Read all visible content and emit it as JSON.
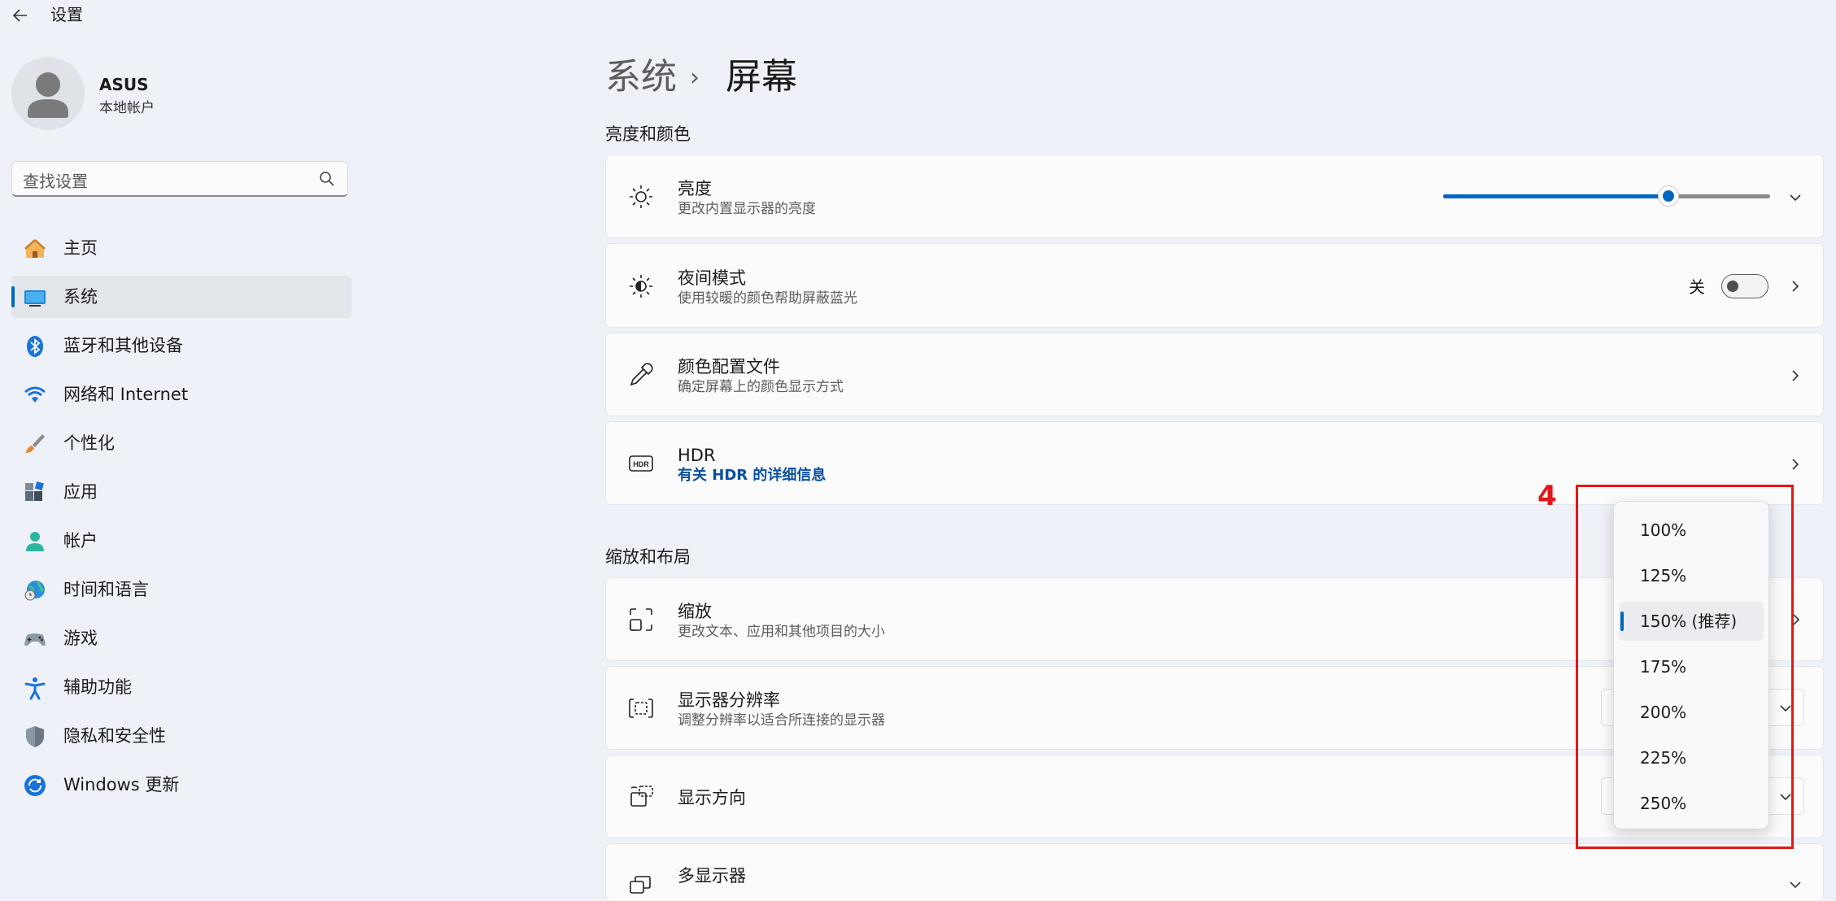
{
  "window": {
    "back_icon": "back-arrow-icon",
    "title": "设置"
  },
  "user": {
    "name": "ASUS",
    "account_type": "本地帐户",
    "avatar_icon": "person-icon"
  },
  "search": {
    "placeholder": "查找设置",
    "icon": "search-icon"
  },
  "nav": {
    "items": [
      {
        "label": "主页",
        "icon": "home-icon",
        "selected": false
      },
      {
        "label": "系统",
        "icon": "system-icon",
        "selected": true
      },
      {
        "label": "蓝牙和其他设备",
        "icon": "bluetooth-icon",
        "selected": false
      },
      {
        "label": "网络和 Internet",
        "icon": "wifi-icon",
        "selected": false
      },
      {
        "label": "个性化",
        "icon": "brush-icon",
        "selected": false
      },
      {
        "label": "应用",
        "icon": "apps-icon",
        "selected": false
      },
      {
        "label": "帐户",
        "icon": "account-icon",
        "selected": false
      },
      {
        "label": "时间和语言",
        "icon": "globe-clock-icon",
        "selected": false
      },
      {
        "label": "游戏",
        "icon": "gamepad-icon",
        "selected": false
      },
      {
        "label": "辅助功能",
        "icon": "accessibility-icon",
        "selected": false
      },
      {
        "label": "隐私和安全性",
        "icon": "shield-icon",
        "selected": false
      },
      {
        "label": "Windows 更新",
        "icon": "update-icon",
        "selected": false
      }
    ]
  },
  "breadcrumb": {
    "parent": "系统",
    "separator": "›",
    "current": "屏幕"
  },
  "sections": {
    "brightness_color": {
      "heading": "亮度和颜色",
      "brightness": {
        "title": "亮度",
        "subtitle": "更改内置显示器的亮度",
        "value_percent": 69,
        "icon": "sun-icon"
      },
      "night_light": {
        "title": "夜间模式",
        "subtitle": "使用较暖的颜色帮助屏蔽蓝光",
        "state_label": "关",
        "on": false,
        "icon": "night-light-icon"
      },
      "color_profile": {
        "title": "颜色配置文件",
        "subtitle": "确定屏幕上的颜色显示方式",
        "icon": "eyedropper-icon"
      },
      "hdr": {
        "title": "HDR",
        "link": "有关 HDR 的详细信息",
        "icon": "hdr-icon"
      }
    },
    "scale_layout": {
      "heading": "缩放和布局",
      "scale": {
        "title": "缩放",
        "subtitle": "更改文本、应用和其他项目的大小",
        "icon": "scale-icon"
      },
      "resolution": {
        "title": "显示器分辨率",
        "subtitle": "调整分辨率以适合所连接的显示器",
        "icon": "resolution-icon"
      },
      "orientation": {
        "title": "显示方向",
        "icon": "orientation-icon"
      },
      "multi_display": {
        "title": "多显示器",
        "icon": "multi-display-icon"
      }
    }
  },
  "scale_flyout": {
    "options": [
      "100%",
      "125%",
      "150% (推荐)",
      "175%",
      "200%",
      "225%",
      "250%"
    ],
    "selected_index": 2
  },
  "annotation": {
    "label": "4",
    "color": "#e01818"
  },
  "colors": {
    "accent": "#0067c0",
    "background": "#eef1f7",
    "card": "#fbfbfc"
  }
}
